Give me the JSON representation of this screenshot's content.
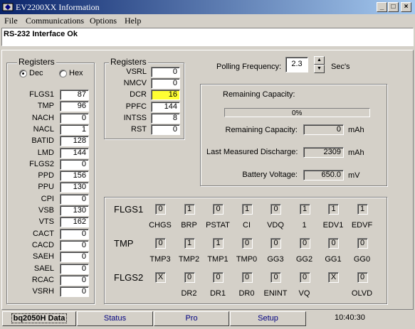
{
  "window": {
    "title": "EV2200XX Information",
    "minimize": "_",
    "maximize": "□",
    "close": "×"
  },
  "menu": [
    "File",
    "Communications",
    "Options",
    "Help"
  ],
  "status_message": "RS-232 Interface Ok",
  "left_registers": {
    "title": "Registers",
    "radio_dec": "Dec",
    "radio_hex": "Hex",
    "selected": "Dec",
    "rows": [
      {
        "label": "FLGS1",
        "value": "87"
      },
      {
        "label": "TMP",
        "value": "96"
      },
      {
        "label": "NACH",
        "value": "0"
      },
      {
        "label": "NACL",
        "value": "1"
      },
      {
        "label": "BATID",
        "value": "128"
      },
      {
        "label": "LMD",
        "value": "144"
      },
      {
        "label": "FLGS2",
        "value": "0"
      },
      {
        "label": "PPD",
        "value": "156"
      },
      {
        "label": "PPU",
        "value": "130"
      },
      {
        "label": "CPI",
        "value": "0"
      },
      {
        "label": "VSB",
        "value": "130"
      },
      {
        "label": "VTS",
        "value": "162"
      },
      {
        "label": "CACT",
        "value": "0"
      },
      {
        "label": "CACD",
        "value": "0"
      },
      {
        "label": "SAEH",
        "value": "0"
      },
      {
        "label": "SAEL",
        "value": "0"
      },
      {
        "label": "RCAC",
        "value": "0"
      },
      {
        "label": "VSRH",
        "value": "0"
      }
    ]
  },
  "mid_registers": {
    "title": "Registers",
    "highlight_color": "#ffff33",
    "rows": [
      {
        "label": "VSRL",
        "value": "0"
      },
      {
        "label": "NMCV",
        "value": "0"
      },
      {
        "label": "DCR",
        "value": "16",
        "highlight": true
      },
      {
        "label": "PPFC",
        "value": "144"
      },
      {
        "label": "INTSS",
        "value": "8"
      },
      {
        "label": "RST",
        "value": "0"
      }
    ]
  },
  "polling": {
    "label": "Polling Frequency:",
    "value": "2.3",
    "unit": "Sec's"
  },
  "capacity": {
    "remaining_title": "Remaining Capacity:",
    "progress_text": "0%",
    "progress_fraction": 0,
    "remaining_label": "Remaining Capacity:",
    "remaining_value": "0",
    "remaining_unit": "mAh",
    "lmd_label": "Last Measured Discharge:",
    "lmd_value": "2309",
    "lmd_unit": "mAh",
    "voltage_label": "Battery Voltage:",
    "voltage_value": "650.0",
    "voltage_unit": "mV"
  },
  "flags": [
    {
      "name": "FLGS1",
      "bits": [
        "0",
        "1",
        "0",
        "1",
        "0",
        "1",
        "1",
        "1"
      ],
      "names": [
        "CHGS",
        "BRP",
        "PSTAT",
        "CI",
        "VDQ",
        "1",
        "EDV1",
        "EDVF"
      ]
    },
    {
      "name": "TMP",
      "bits": [
        "0",
        "1",
        "1",
        "0",
        "0",
        "0",
        "0",
        "0"
      ],
      "names": [
        "TMP3",
        "TMP2",
        "TMP1",
        "TMP0",
        "GG3",
        "GG2",
        "GG1",
        "GG0"
      ]
    },
    {
      "name": "FLGS2",
      "bits": [
        "X",
        "0",
        "0",
        "0",
        "0",
        "0",
        "X",
        "0"
      ],
      "names": [
        "",
        "DR2",
        "DR1",
        "DR0",
        "ENINT",
        "VQ",
        "",
        "OLVD"
      ]
    }
  ],
  "tabs": [
    {
      "label": "bq2050H Data",
      "active": true
    },
    {
      "label": "Status",
      "active": false
    },
    {
      "label": "Pro",
      "active": false
    },
    {
      "label": "Setup",
      "active": false
    }
  ],
  "clock": "10:40:30"
}
